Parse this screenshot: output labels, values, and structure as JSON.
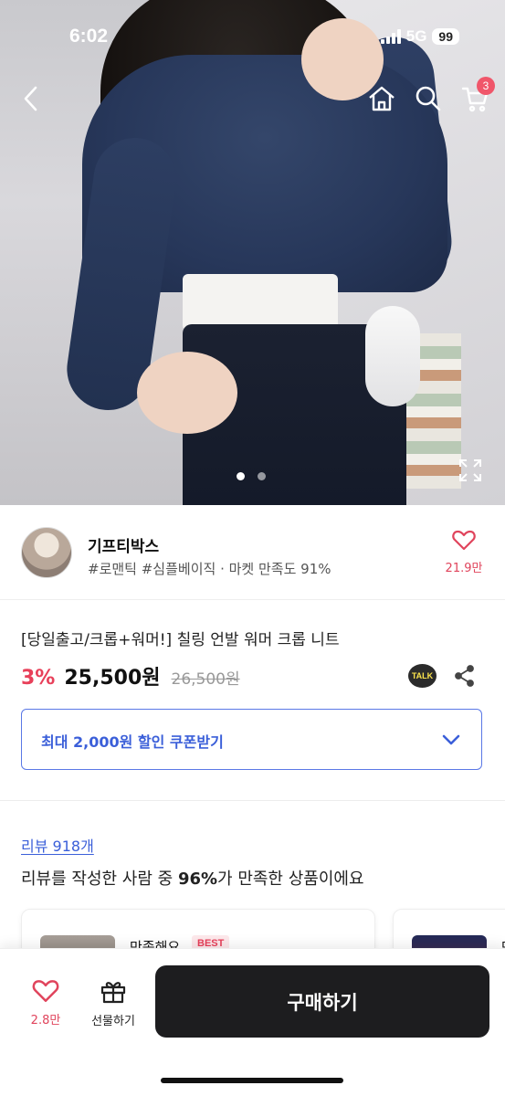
{
  "status_bar": {
    "time": "6:02",
    "network": "5G",
    "battery": "99"
  },
  "nav": {
    "back_icon": "chevron-left-icon",
    "home_icon": "home-icon",
    "search_icon": "search-icon",
    "cart_icon": "cart-icon",
    "cart_count": "3"
  },
  "gallery": {
    "image_count": 2,
    "active_index": 0
  },
  "shop": {
    "name": "기프티박스",
    "tags": "#로맨틱 #심플베이직 · 마켓 만족도 91%",
    "like_count": "21.9만"
  },
  "product": {
    "title": "[당일출고/크롭+워머!] 칠링 언발 워머 크롭 니트",
    "discount": "3%",
    "price": "25,500원",
    "original_price": "26,500원",
    "talk_label": "TALK"
  },
  "coupon": {
    "label": "최대 2,000원 할인 쿠폰받기"
  },
  "reviews": {
    "link": "리뷰 918개",
    "summary_prefix": "리뷰를 작성한 사람 중 ",
    "summary_percent": "96%",
    "summary_suffix": "가 만족한 상품이에요",
    "cards": [
      {
        "title": "만족해요",
        "badge": "BEST"
      },
      {
        "title": "만"
      }
    ]
  },
  "bottom_bar": {
    "like_count": "2.8만",
    "gift_label": "선물하기",
    "buy_label": "구매하기"
  },
  "colors": {
    "accent_pink": "#e8405a",
    "accent_blue": "#3b5fd9",
    "buy_button": "#1d1d1f"
  }
}
